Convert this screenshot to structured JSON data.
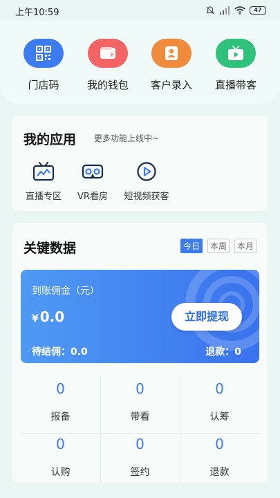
{
  "status_bar": {
    "time": "上午10:59",
    "battery": "47"
  },
  "quick_actions": [
    {
      "label": "门店码",
      "icon": "qr-code-icon",
      "color": "#3d7bf0"
    },
    {
      "label": "我的钱包",
      "icon": "wallet-icon",
      "color": "#f46464"
    },
    {
      "label": "客户录入",
      "icon": "user-card-icon",
      "color": "#f08a3c"
    },
    {
      "label": "直播带客",
      "icon": "tv-play-icon",
      "color": "#2ec27a"
    }
  ],
  "apps": {
    "title": "我的应用",
    "subtitle": "更多功能上线中~",
    "items": [
      {
        "label": "直播专区",
        "icon": "live-tv-icon"
      },
      {
        "label": "VR看房",
        "icon": "vr-goggles-icon"
      },
      {
        "label": "短视频获客",
        "icon": "play-circle-icon"
      }
    ]
  },
  "key_data": {
    "title": "关键数据",
    "tabs": [
      "今日",
      "本周",
      "本月"
    ],
    "active_tab": "今日",
    "commission_label": "到账佣金（元）",
    "currency": "¥",
    "commission_value": "0.0",
    "withdraw_button": "立即提现",
    "pending_label": "待结佣：0.0",
    "refund_label": "退款：0",
    "stats": [
      {
        "value": "0",
        "label": "报备"
      },
      {
        "value": "0",
        "label": "带看"
      },
      {
        "value": "0",
        "label": "认筹"
      },
      {
        "value": "0",
        "label": "认购"
      },
      {
        "value": "0",
        "label": "签约"
      },
      {
        "value": "0",
        "label": "退款"
      }
    ]
  }
}
